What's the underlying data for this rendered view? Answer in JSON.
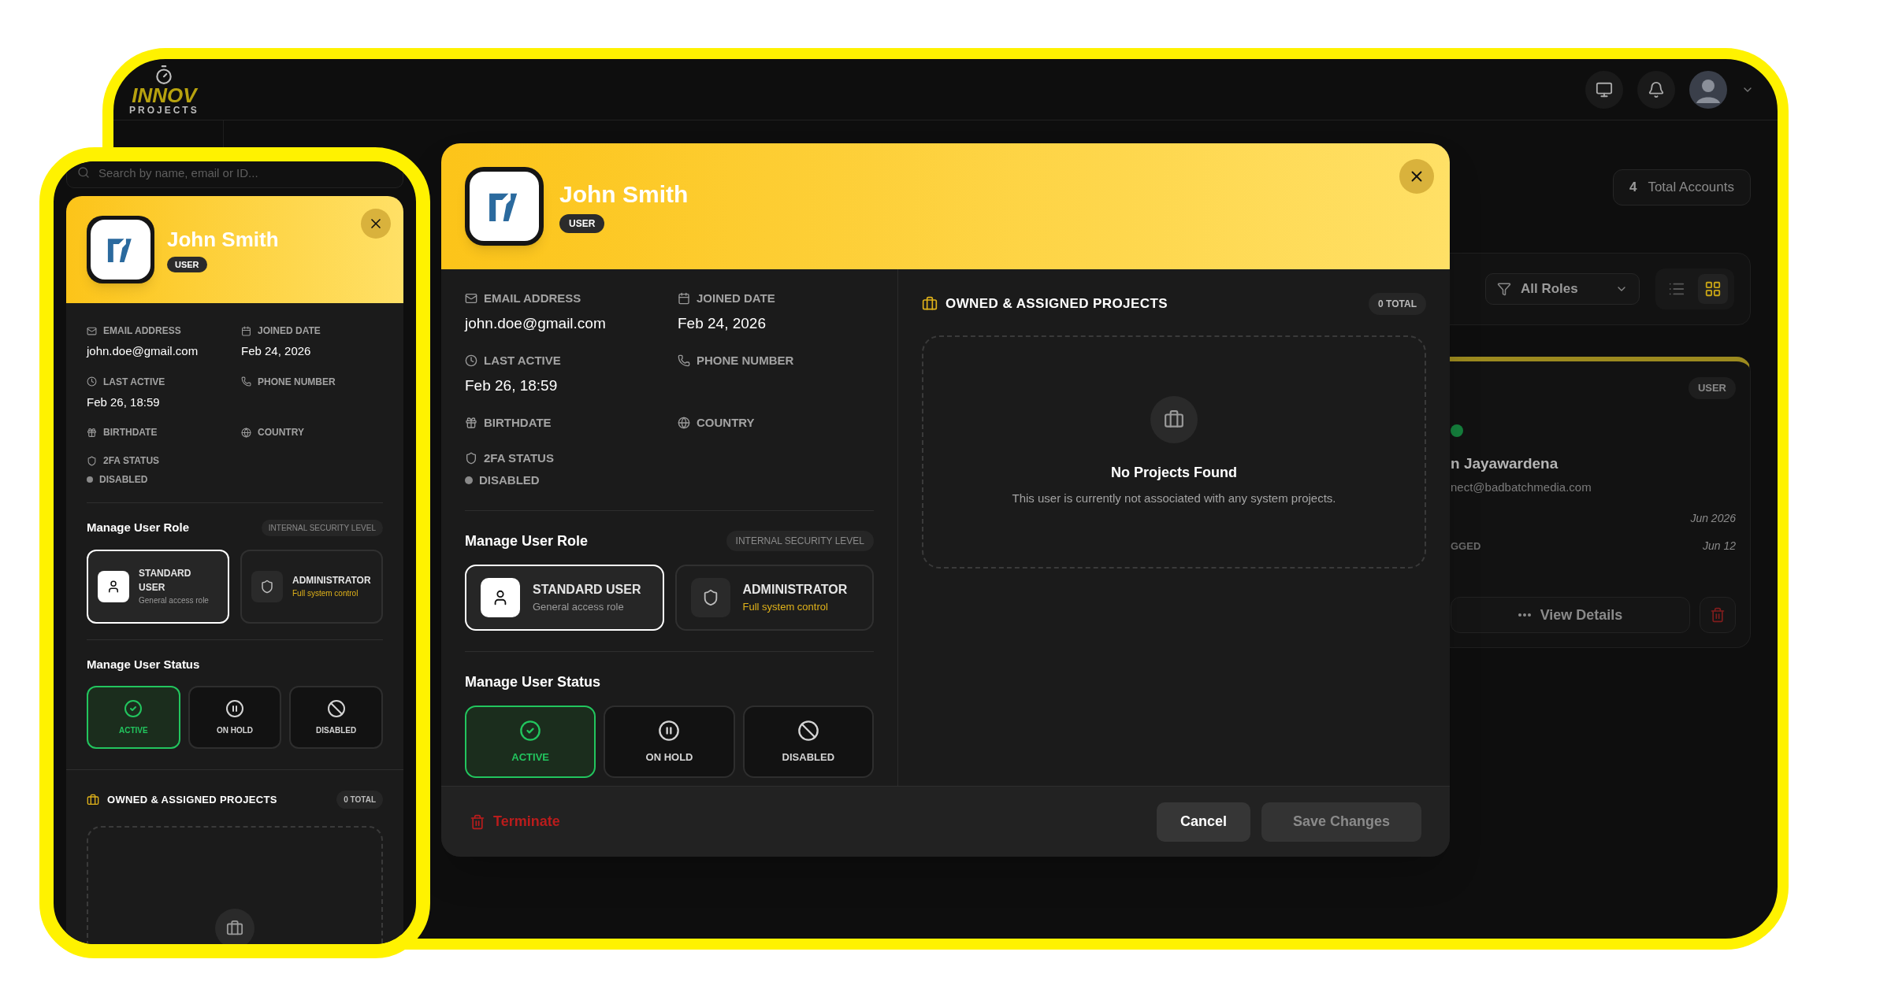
{
  "desktop": {
    "logo": {
      "name": "INNOV",
      "tagline": "PROJECTS"
    },
    "total_accounts": {
      "count": "4",
      "label": "Total Accounts"
    },
    "role_filter": {
      "value": "All Roles"
    },
    "view_toggle": [
      {
        "kind": "list",
        "selected": false
      },
      {
        "kind": "grid",
        "selected": true
      }
    ],
    "user_card": {
      "badge": "USER",
      "online": true,
      "name": "n Jayawardena",
      "email": "nect@badbatchmedia.com",
      "rows": [
        {
          "value": "Jun 2026"
        },
        {
          "label": "GGED",
          "value": "Jun 12"
        }
      ],
      "action": "View Details"
    },
    "modal": {
      "name": "John Smith",
      "role_badge": "USER",
      "fields": [
        {
          "kind": "email",
          "label": "EMAIL ADDRESS",
          "value": "john.doe@gmail.com"
        },
        {
          "kind": "joined",
          "label": "JOINED DATE",
          "value": "Feb 24, 2026"
        },
        {
          "kind": "last_active",
          "label": "LAST ACTIVE",
          "value": "Feb 26, 18:59"
        },
        {
          "kind": "phone",
          "label": "PHONE NUMBER"
        },
        {
          "kind": "birthdate",
          "label": "BIRTHDATE"
        },
        {
          "kind": "country",
          "label": "COUNTRY"
        },
        {
          "kind": "twofa",
          "label": "2FA STATUS",
          "value": "DISABLED"
        }
      ],
      "role_section": {
        "title": "Manage User Role",
        "badge": "INTERNAL SECURITY LEVEL",
        "options": [
          {
            "kind": "standard",
            "title": "STANDARD USER",
            "subtitle": "General access role",
            "selected": true
          },
          {
            "kind": "admin",
            "title": "ADMINISTRATOR",
            "subtitle": "Full system control",
            "selected": false
          }
        ]
      },
      "status_section": {
        "title": "Manage User Status",
        "options": [
          {
            "kind": "active",
            "label": "ACTIVE",
            "selected": true
          },
          {
            "kind": "hold",
            "label": "ON HOLD",
            "selected": false
          },
          {
            "kind": "disabled",
            "label": "DISABLED",
            "selected": false
          }
        ]
      },
      "projects": {
        "title": "OWNED & ASSIGNED PROJECTS",
        "count": "0 TOTAL",
        "empty_title": "No Projects Found",
        "empty_text": "This user is currently not associated with any system projects."
      },
      "footer": {
        "terminate": "Terminate",
        "cancel": "Cancel",
        "save": "Save Changes",
        "save_disabled": true
      }
    }
  },
  "mobile": {
    "search": {
      "placeholder": "Search by name, email or ID..."
    },
    "modal": {
      "name": "John Smith",
      "role_badge": "USER",
      "fields": [
        {
          "kind": "email",
          "label": "EMAIL ADDRESS",
          "value": "john.doe@gmail.com"
        },
        {
          "kind": "joined",
          "label": "JOINED DATE",
          "value": "Feb 24, 2026"
        },
        {
          "kind": "last_active",
          "label": "LAST ACTIVE",
          "value": "Feb 26, 18:59"
        },
        {
          "kind": "phone",
          "label": "PHONE NUMBER"
        },
        {
          "kind": "birthdate",
          "label": "BIRTHDATE"
        },
        {
          "kind": "country",
          "label": "COUNTRY"
        },
        {
          "kind": "twofa",
          "label": "2FA STATUS",
          "value": "DISABLED"
        }
      ],
      "role_section": {
        "title": "Manage User Role",
        "badge": "INTERNAL SECURITY LEVEL",
        "options": [
          {
            "kind": "standard",
            "title": "STANDARD USER",
            "subtitle": "General access role",
            "selected": true
          },
          {
            "kind": "admin",
            "title": "ADMINISTRATOR",
            "subtitle": "Full system control",
            "selected": false
          }
        ]
      },
      "status_section": {
        "title": "Manage User Status",
        "options": [
          {
            "kind": "active",
            "label": "ACTIVE",
            "selected": true
          },
          {
            "kind": "hold",
            "label": "ON HOLD",
            "selected": false
          },
          {
            "kind": "disabled",
            "label": "DISABLED",
            "selected": false
          }
        ]
      },
      "projects": {
        "title": "OWNED & ASSIGNED PROJECTS",
        "count": "0 TOTAL"
      }
    }
  }
}
